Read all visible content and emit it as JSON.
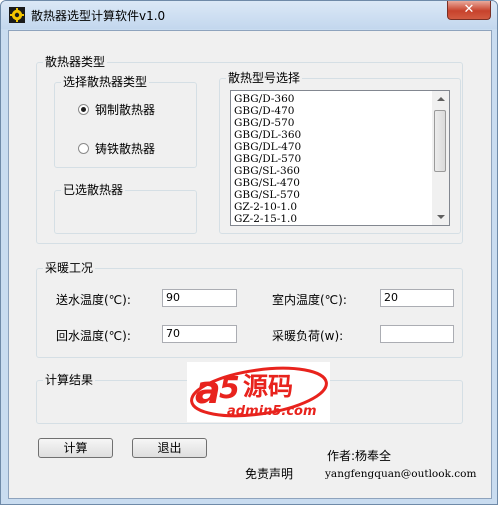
{
  "window": {
    "title": "散热器选型计算软件v1.0",
    "close_label": "✕"
  },
  "radiator_type_group": {
    "title": "散热器类型"
  },
  "select_type_group": {
    "title": "选择散热器类型",
    "options": [
      {
        "label": "钢制散热器",
        "selected": true
      },
      {
        "label": "铸铁散热器",
        "selected": false
      }
    ]
  },
  "selected_group": {
    "title": "已选散热器"
  },
  "model_group": {
    "title": "散热型号选择",
    "items": [
      "GBG/D-360",
      "GBG/D-470",
      "GBG/D-570",
      "GBG/DL-360",
      "GBG/DL-470",
      "GBG/DL-570",
      "GBG/SL-360",
      "GBG/SL-470",
      "GBG/SL-570",
      "GZ-2-10-1.0",
      "GZ-2-15-1.0"
    ]
  },
  "heating_group": {
    "title": "采暖工况",
    "supply_temp_label": "送水温度(℃):",
    "supply_temp_value": "90",
    "return_temp_label": "回水温度(℃):",
    "return_temp_value": "70",
    "indoor_temp_label": "室内温度(℃):",
    "indoor_temp_value": "20",
    "heat_load_label": "采暖负荷(w):",
    "heat_load_value": ""
  },
  "result_group": {
    "title": "计算结果"
  },
  "watermark": {
    "text_a": "a",
    "text_5": "5",
    "text_cn": "源码",
    "text_url": "admin5.com"
  },
  "buttons": {
    "calculate": "计算",
    "exit": "退出"
  },
  "footer": {
    "author": "作者:杨奉全",
    "disclaimer": "免责声明",
    "email": "yangfengquan@outlook.com"
  },
  "colors": {
    "accent_red": "#e8231d",
    "frame": "#c9dcf0",
    "client_bg": "#f0f0f0"
  }
}
